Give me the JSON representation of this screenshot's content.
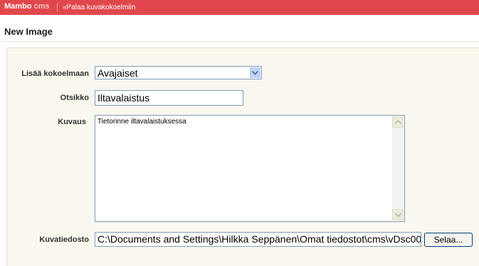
{
  "header": {
    "brand": "Mambo",
    "brand_suffix": "cms",
    "back_link": "«Palaa kuvakokoelmiin"
  },
  "page": {
    "title": "New Image"
  },
  "form": {
    "collection_label": "Lisää kokoelmaan",
    "collection_value": "Avajaiset",
    "title_label": "Otsikko",
    "title_value": "Iltavalaistus",
    "description_label": "Kuvaus",
    "description_value": "Tietorinne iltavalaistuksessa",
    "file_label": "Kuvatiedosto",
    "file_value": "C:\\Documents and Settings\\Hilkka Seppänen\\Omat tiedostot\\cms\\vDsc00",
    "browse_label": "Selaa..."
  },
  "colors": {
    "topbar": "#e0474c",
    "panel": "#faf7ef"
  }
}
